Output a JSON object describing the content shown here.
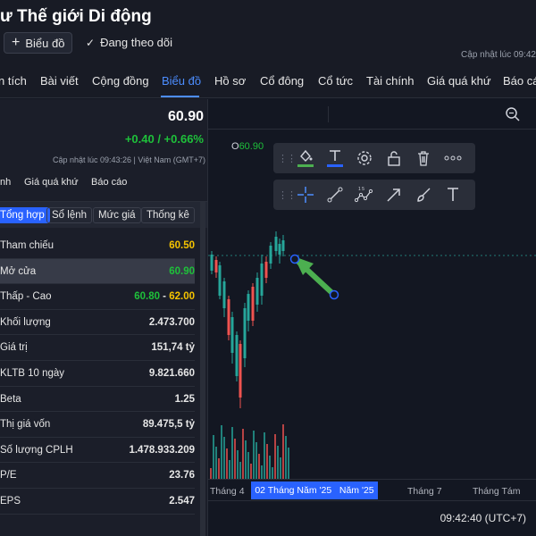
{
  "header": {
    "title": "ư Thế giới Di động",
    "chart_button": "Biểu đồ",
    "follow_label": "Đang theo dõi",
    "update_label": "Cập nhật lúc  09:42"
  },
  "tabs": [
    {
      "label": "n tích"
    },
    {
      "label": "Bài viết"
    },
    {
      "label": "Cộng đồng"
    },
    {
      "label": "Biểu đồ",
      "active": true
    },
    {
      "label": "Hồ sơ"
    },
    {
      "label": "Cổ đông"
    },
    {
      "label": "Cổ tức"
    },
    {
      "label": "Tài chính"
    },
    {
      "label": "Giá quá khứ"
    },
    {
      "label": "Báo cá"
    }
  ],
  "quote": {
    "price": "60.90",
    "change": "+0.40 / +0.66%",
    "update": "Cập nhật lúc  09:43:26 | Việt Nam (GMT+7)"
  },
  "subnav": [
    "nh",
    "Giá quá khứ",
    "Báo cáo"
  ],
  "subtabs": [
    {
      "label": "Tổng hợp",
      "active": true
    },
    {
      "label": "Sổ lệnh"
    },
    {
      "label": "Mức giá"
    },
    {
      "label": "Thống kê"
    }
  ],
  "stats": [
    {
      "label": "Tham chiếu",
      "value": "60.50",
      "color": "yellow"
    },
    {
      "label": "Mở cửa",
      "value": "60.90",
      "color": "green",
      "highlight": true
    },
    {
      "label": "Thấp - Cao",
      "low": "60.80",
      "sep": " - ",
      "high": "62.00"
    },
    {
      "label": "Khối lượng",
      "value": "2.473.700"
    },
    {
      "label": "Giá trị",
      "value": "151,74 tỷ"
    },
    {
      "label": "KLTB 10 ngày",
      "value": "9.821.660"
    },
    {
      "label": "Beta",
      "value": "1.25"
    },
    {
      "label": "Thị giá vốn",
      "value": "89.475,5 tỷ"
    },
    {
      "label": "Số lượng CPLH",
      "value": "1.478.933.209"
    },
    {
      "label": "P/E",
      "value": "23.76"
    },
    {
      "label": "EPS",
      "value": "2.547"
    }
  ],
  "chart": {
    "ohlc_label": "O",
    "ohlc_value": "60.90",
    "time_ticks": [
      "Tháng 4",
      "02 Tháng Năm '25",
      "Năm '25",
      "Tháng 7",
      "Tháng Tám"
    ],
    "clock": "09:42:40 (UTC+7)",
    "colors": {
      "up": "#26a69a",
      "down": "#ef5350",
      "accent": "#2962ff",
      "arrow": "#4caf50"
    }
  },
  "toolbar1_icons": [
    "paint-bucket-icon",
    "text-color-icon",
    "settings-icon",
    "lock-icon",
    "trash-icon",
    "more-icon"
  ],
  "toolbar2_icons": [
    "crosshair-icon",
    "trend-line-icon",
    "pattern-icon",
    "arrow-tool-icon",
    "brush-icon",
    "text-tool-icon"
  ]
}
